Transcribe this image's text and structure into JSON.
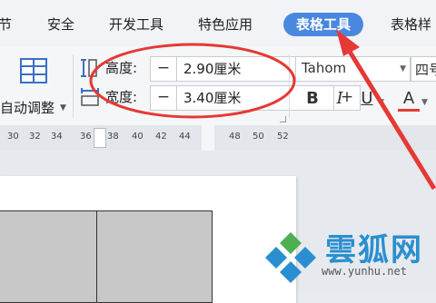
{
  "tabs": [
    {
      "label": "节",
      "active": false
    },
    {
      "label": "安全",
      "active": false
    },
    {
      "label": "开发工具",
      "active": false
    },
    {
      "label": "特色应用",
      "active": false
    },
    {
      "label": "表格工具",
      "active": true
    },
    {
      "label": "表格样",
      "active": false
    }
  ],
  "ribbon": {
    "autofit_label": "自动调整",
    "height": {
      "label": "高度:",
      "value": "2.90厘米",
      "minus": "−",
      "plus": "+"
    },
    "width": {
      "label": "宽度:",
      "value": "3.40厘米",
      "minus": "−",
      "plus": "+"
    },
    "font_name": "Tahom",
    "font_size": "四号",
    "format_buttons": [
      "B",
      "I",
      "U",
      "A"
    ]
  },
  "ruler": {
    "ticks": [
      "30",
      "32",
      "34",
      "36",
      "38",
      "40",
      "42",
      "44",
      "48",
      "50",
      "52"
    ]
  },
  "watermark": {
    "name": "雲狐网",
    "url": "www.yunhu.net"
  },
  "colors": {
    "accent": "#4a88e0",
    "annotation": "#e53935",
    "cell_fill": "#c8c8c8"
  }
}
